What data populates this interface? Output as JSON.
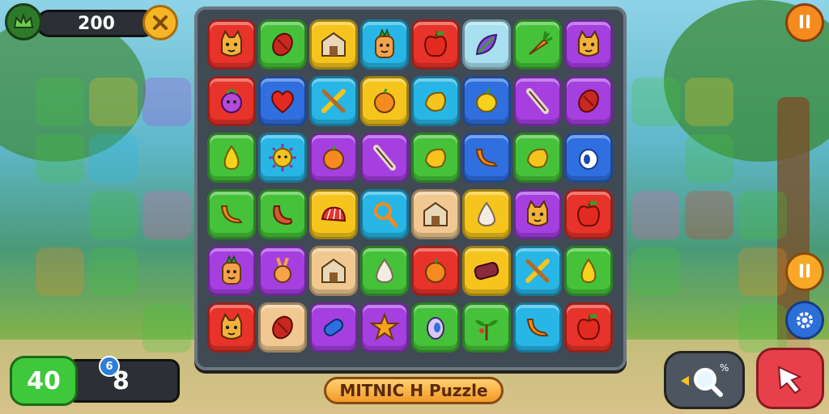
{
  "header": {
    "score": "200"
  },
  "moves": {
    "main": "40",
    "badge": "6",
    "secondary": "8"
  },
  "title": "MITNIC H Puzzle",
  "buttons": {
    "pause_top": "II",
    "pause_side": "II"
  },
  "colors": {
    "red": "#e8332a",
    "green": "#45c23a",
    "yellow": "#f5c51d",
    "cyan": "#27b6e6",
    "purple": "#a53fe0",
    "blue": "#2f6fe0",
    "orange": "#f58a1e",
    "peach": "#f1c891",
    "lightblue": "#a9e0f0",
    "pink": "#f05ab0"
  },
  "tiles": [
    [
      {
        "c": "red",
        "icon": "cat-face-icon"
      },
      {
        "c": "green",
        "icon": "red-bean-icon"
      },
      {
        "c": "yellow",
        "icon": "house-icon"
      },
      {
        "c": "cyan",
        "icon": "pineapple-face-icon"
      },
      {
        "c": "red",
        "icon": "apple-icon"
      },
      {
        "c": "lightblue",
        "icon": "leaf-icon"
      },
      {
        "c": "green",
        "icon": "carrot-icon"
      },
      {
        "c": "purple",
        "icon": "cat-face-icon"
      }
    ],
    [
      {
        "c": "red",
        "icon": "grape-face-icon"
      },
      {
        "c": "blue",
        "icon": "heart-fruit-icon"
      },
      {
        "c": "cyan",
        "icon": "crossed-sticks-icon"
      },
      {
        "c": "yellow",
        "icon": "orange-icon"
      },
      {
        "c": "cyan",
        "icon": "mango-icon"
      },
      {
        "c": "blue",
        "icon": "lemon-icon"
      },
      {
        "c": "purple",
        "icon": "stick-icon"
      },
      {
        "c": "purple",
        "icon": "red-bean-icon"
      }
    ],
    [
      {
        "c": "green",
        "icon": "pear-icon"
      },
      {
        "c": "cyan",
        "icon": "sun-face-icon"
      },
      {
        "c": "purple",
        "icon": "orange-icon"
      },
      {
        "c": "purple",
        "icon": "stick-icon"
      },
      {
        "c": "green",
        "icon": "mango-icon"
      },
      {
        "c": "blue",
        "icon": "banana-icon"
      },
      {
        "c": "green",
        "icon": "mango-icon"
      },
      {
        "c": "blue",
        "icon": "eye-fruit-icon"
      }
    ],
    [
      {
        "c": "green",
        "icon": "banana-icon"
      },
      {
        "c": "green",
        "icon": "sausage-icon"
      },
      {
        "c": "yellow",
        "icon": "shell-icon"
      },
      {
        "c": "cyan",
        "icon": "magnifier-icon"
      },
      {
        "c": "peach",
        "icon": "house-icon"
      },
      {
        "c": "yellow",
        "icon": "garlic-icon"
      },
      {
        "c": "purple",
        "icon": "cat-face-icon"
      },
      {
        "c": "red",
        "icon": "apple-icon"
      }
    ],
    [
      {
        "c": "purple",
        "icon": "pineapple-face-icon"
      },
      {
        "c": "purple",
        "icon": "bunny-icon"
      },
      {
        "c": "peach",
        "icon": "house-icon"
      },
      {
        "c": "green",
        "icon": "garlic-icon"
      },
      {
        "c": "red",
        "icon": "orange-icon"
      },
      {
        "c": "yellow",
        "icon": "scroll-icon"
      },
      {
        "c": "cyan",
        "icon": "crossed-sticks-icon"
      },
      {
        "c": "green",
        "icon": "pear-icon"
      }
    ],
    [
      {
        "c": "red",
        "icon": "cat-face-icon"
      },
      {
        "c": "peach",
        "icon": "red-bean-icon"
      },
      {
        "c": "purple",
        "icon": "capsule-icon"
      },
      {
        "c": "purple",
        "icon": "star-icon"
      },
      {
        "c": "green",
        "icon": "egg-icon"
      },
      {
        "c": "green",
        "icon": "plant-icon"
      },
      {
        "c": "cyan",
        "icon": "banana-icon"
      },
      {
        "c": "red",
        "icon": "apple-icon"
      }
    ]
  ]
}
